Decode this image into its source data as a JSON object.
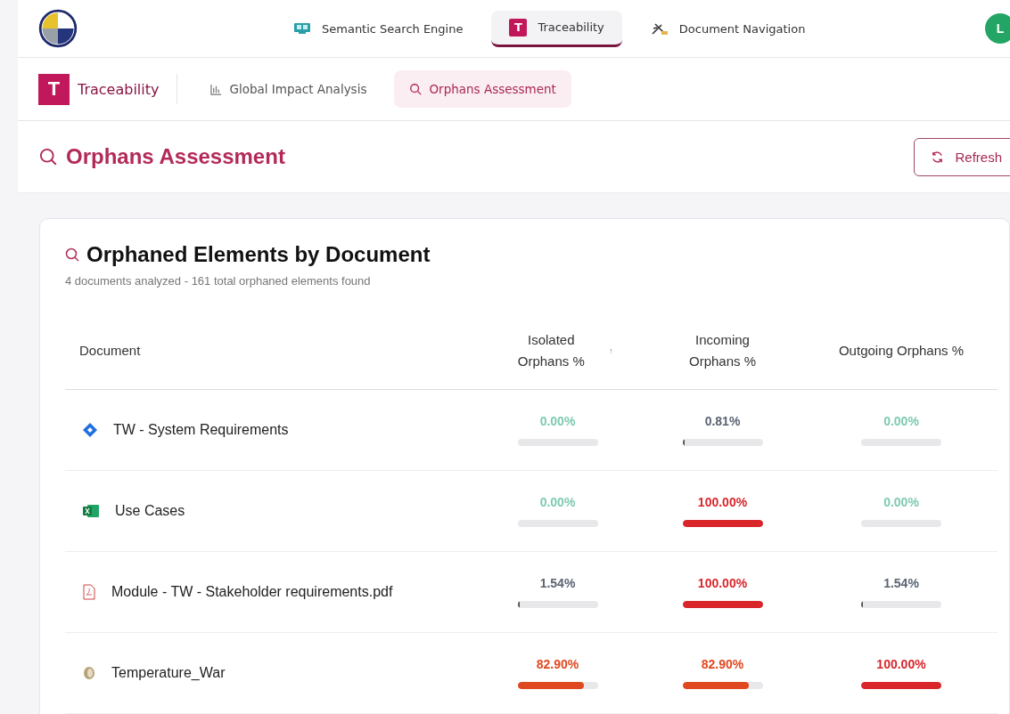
{
  "top_nav": {
    "tabs": [
      {
        "label": "Semantic Search Engine",
        "selected": false
      },
      {
        "label": "Traceability",
        "letter": "T",
        "selected": true
      },
      {
        "label": "Document Navigation",
        "selected": false
      }
    ],
    "avatar": "L"
  },
  "sub_nav": {
    "brand_letter": "T",
    "brand": "Traceability",
    "tabs": [
      {
        "label": "Global Impact Analysis",
        "selected": false
      },
      {
        "label": "Orphans Assessment",
        "selected": true
      }
    ]
  },
  "page_header": {
    "title": "Orphans Assessment",
    "refresh_button": "Refresh"
  },
  "card": {
    "title": "Orphaned Elements by Document",
    "subtitle": "4 documents analyzed - 161 total orphaned elements found",
    "columns": [
      {
        "label": "Document"
      },
      {
        "label": "Isolated Orphans %",
        "sort": "↑"
      },
      {
        "label": "Incoming Orphans %"
      },
      {
        "label": "Outgoing Orphans %"
      }
    ],
    "rows": [
      {
        "document": "TW - System Requirements",
        "kind": "diamond",
        "isolated": {
          "reading": "0.00%",
          "level": 0
        },
        "incoming": {
          "reading": "0.81%",
          "level": 0.0081
        },
        "outgoing": {
          "reading": "0.00%",
          "level": 0
        }
      },
      {
        "document": "Use Cases",
        "kind": "excel",
        "isolated": {
          "reading": "0.00%",
          "level": 0
        },
        "incoming": {
          "reading": "100.00%",
          "level": 1
        },
        "outgoing": {
          "reading": "0.00%",
          "level": 0
        }
      },
      {
        "document": "Module - TW - Stakeholder requirements.pdf",
        "kind": "pdf",
        "isolated": {
          "reading": "1.54%",
          "level": 0.0154
        },
        "incoming": {
          "reading": "100.00%",
          "level": 1
        },
        "outgoing": {
          "reading": "1.54%",
          "level": 0.0154
        }
      },
      {
        "document": "Temperature_War",
        "kind": "scroll",
        "isolated": {
          "reading": "82.90%",
          "level": 0.829
        },
        "incoming": {
          "reading": "82.90%",
          "level": 0.829
        },
        "outgoing": {
          "reading": "100.00%",
          "level": 1
        }
      }
    ]
  }
}
